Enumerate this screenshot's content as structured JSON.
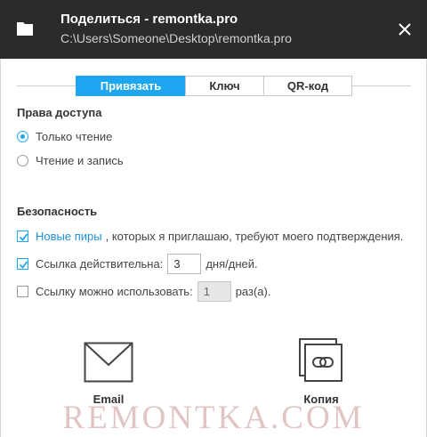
{
  "window": {
    "title": "Поделиться - remontka.pro",
    "path": "C:\\Users\\Someone\\Desktop\\remontka.pro"
  },
  "tabs": [
    {
      "label": "Привязать",
      "active": true
    },
    {
      "label": "Ключ",
      "active": false
    },
    {
      "label": "QR-код",
      "active": false
    }
  ],
  "access": {
    "heading": "Права доступа",
    "options": [
      {
        "label": "Только чтение",
        "selected": true
      },
      {
        "label": "Чтение и запись",
        "selected": false
      }
    ]
  },
  "security": {
    "heading": "Безопасность",
    "new_peers": {
      "checked": true,
      "link": "Новые пиры",
      "text": ", которых я приглашаю, требуют моего подтверждения."
    },
    "link_valid": {
      "checked": true,
      "label": "Ссылка действительна:",
      "value": "3",
      "unit": "дня/дней."
    },
    "link_uses": {
      "checked": false,
      "label": "Ссылку можно использовать:",
      "value": "1",
      "unit": "раз(а)."
    }
  },
  "actions": {
    "email_label": "Email",
    "copy_label": "Копия"
  },
  "watermark": "REMONTKA.COM",
  "colors": {
    "accent": "#1ea7f0",
    "titlebar": "#2b2b2b"
  },
  "icons": [
    "folder-icon",
    "close-icon",
    "envelope-icon",
    "copy-link-icon",
    "checkmark-icon"
  ]
}
